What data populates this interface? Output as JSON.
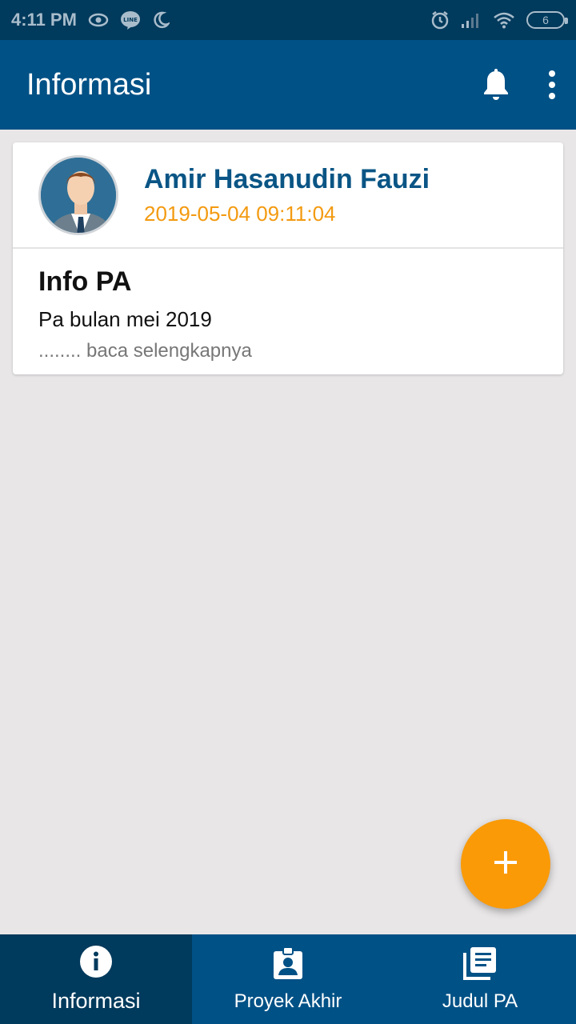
{
  "status_bar": {
    "time": "4:11 PM",
    "left_icons": [
      "eye-icon",
      "line-app-icon",
      "moon-icon"
    ],
    "right_icons": [
      "alarm-icon",
      "signal-icon",
      "wifi-icon"
    ],
    "battery_level": "6"
  },
  "app_bar": {
    "title": "Informasi",
    "icons": [
      "bell-icon",
      "more-vert-icon"
    ],
    "color": "#005186"
  },
  "post": {
    "author_name": "Amir Hasanudin Fauzi",
    "date": "2019-05-04 09:11:04",
    "title": "Info PA",
    "text": "Pa bulan mei 2019",
    "read_more": "........ baca selengkapnya"
  },
  "fab": {
    "icon": "plus-icon",
    "color": "#fa9a06"
  },
  "bottom_nav": {
    "items": [
      {
        "label": "Informasi",
        "icon": "info-icon",
        "active": true
      },
      {
        "label": "Proyek Akhir",
        "icon": "badge-icon",
        "active": false
      },
      {
        "label": "Judul PA",
        "icon": "library-books-icon",
        "active": false
      }
    ]
  },
  "colors": {
    "status_bar": "#003a5c",
    "author": "#0a5585",
    "date": "#f39a10",
    "background": "#e8e6e7"
  }
}
